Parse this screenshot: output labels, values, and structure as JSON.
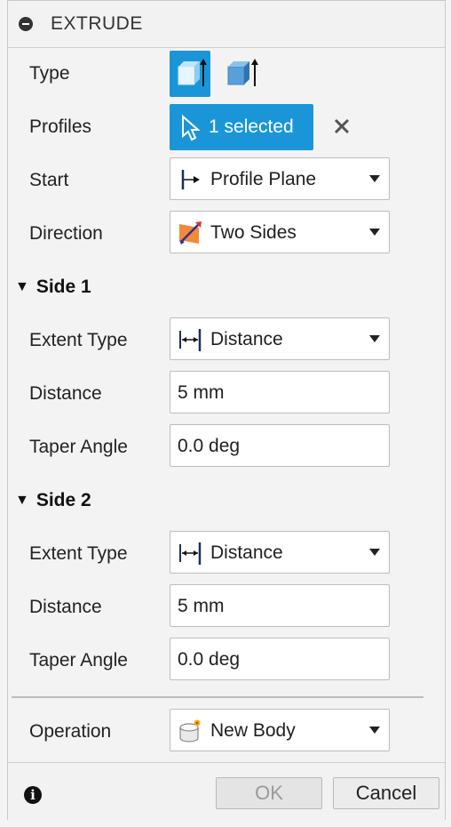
{
  "dialog": {
    "title": "EXTRUDE"
  },
  "rows": {
    "type": {
      "label": "Type"
    },
    "profiles": {
      "label": "Profiles",
      "selected_text": "1 selected"
    },
    "start": {
      "label": "Start",
      "value": "Profile Plane",
      "icon": "profile-plane-icon"
    },
    "direction": {
      "label": "Direction",
      "value": "Two Sides",
      "icon": "two-sides-icon"
    }
  },
  "side1": {
    "header": "Side 1",
    "extent_type": {
      "label": "Extent Type",
      "value": "Distance"
    },
    "distance": {
      "label": "Distance",
      "value": "5 mm"
    },
    "taper": {
      "label": "Taper Angle",
      "value": "0.0 deg"
    }
  },
  "side2": {
    "header": "Side 2",
    "extent_type": {
      "label": "Extent Type",
      "value": "Distance"
    },
    "distance": {
      "label": "Distance",
      "value": "5 mm"
    },
    "taper": {
      "label": "Taper Angle",
      "value": "0.0 deg"
    }
  },
  "operation": {
    "label": "Operation",
    "value": "New Body",
    "icon": "new-body-icon"
  },
  "footer": {
    "ok_label": "OK",
    "cancel_label": "Cancel"
  },
  "colors": {
    "accent": "#1a96d8",
    "panel_bg": "#f3f3f3"
  }
}
